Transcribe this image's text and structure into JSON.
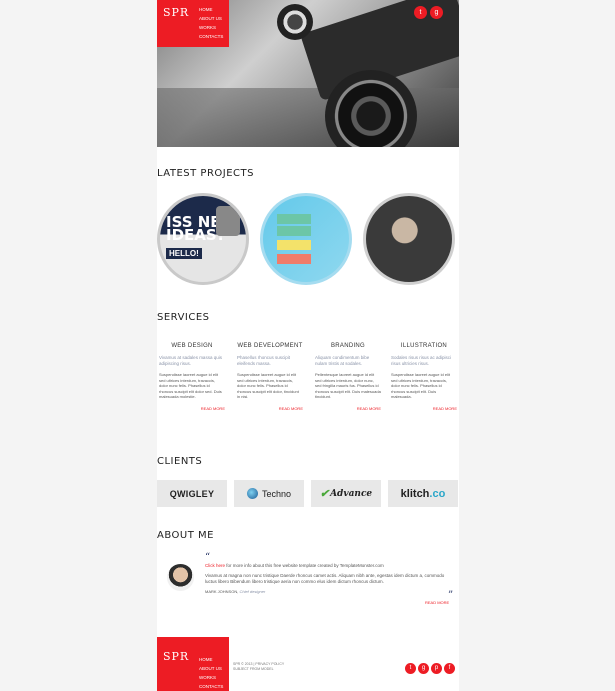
{
  "header": {
    "logo": "SPR",
    "nav": [
      "HOME",
      "ABOUT US",
      "WORKS",
      "CONTACTS"
    ],
    "social": [
      "twitter-icon",
      "google-plus-icon"
    ]
  },
  "sections": {
    "latest_projects": "LATEST PROJECTS",
    "services": "SERVICES",
    "clients": "CLIENTS",
    "about_me": "ABOUT ME"
  },
  "projects": {
    "p1_big": "ISS NEW IDEAS?",
    "p1_hello": "HELLO!"
  },
  "services": [
    {
      "title": "WEB DESIGN",
      "lead": "Vivamus at sadales massa quis adipiscing risus.",
      "text": "Suspendisse laoreet augue id elit sed ultrices interdum, travaccis, dolor nunc felis. Phasellus id rhoncus suscipit elit dolor sed. Duis malesuada molestie.",
      "more": "READ MORE"
    },
    {
      "title": "WEB DEVELOPMENT",
      "lead": "Phasellus rhoncus suscipit eleifends massa.",
      "text": "Suspendisse laoreet augue id elit sed ultrices interdum, travaccis, dolor nunc felis. Phasellus id rhoncus suscipit elit dolor, tincidunt in nisi.",
      "more": "READ MORE"
    },
    {
      "title": "BRANDING",
      "lead": "Aliquam condimentum bibe nulam tristis at sodales.",
      "text": "Pellentesque laoreet augue id elit sed ultrices interdum, dolor nunc, sed fringilla mauris fus. Phasellus id rhoncus suscipit elit. Duis malesuada tincidunt.",
      "more": "READ MORE"
    },
    {
      "title": "ILLUSTRATION",
      "lead": "Sodales risus risus ac adipisci risus ultricies risus.",
      "text": "Suspendisse laoreet augue id elit sed ultrices interdum, travaccis, dolor nunc felis. Phasellus id rhoncus suscipit elit. Duis malesuada.",
      "more": "READ MORE"
    }
  ],
  "clients": {
    "c1": "QWIGLEY",
    "c2": "Techno",
    "c3": "Advance",
    "c4_main": "klitch",
    "c4_co": ".co"
  },
  "about": {
    "link_text": "Click here",
    "intro": " for more info about this free website template created by TemplateMonster.com",
    "body": "Vivamus at magna non nunc tristique Daerde rhoncus camet actis. Aliquam nibh ante, egestas idem dictum a, commodo luctus libero Bibendum libero tristique aeria non commo elus idem dictum rhoncus dictum.",
    "name": "MARK JOHNSON,",
    "role": " Chief designer",
    "more": "READ MORE"
  },
  "footer": {
    "logo": "SPR",
    "nav": [
      "HOME",
      "ABOUT US",
      "WORKS",
      "CONTACTS"
    ],
    "copy": "SPR © 2013 | PRIVACY POLICY",
    "copy2": "SUBJECT FROM MODEL",
    "social": [
      "twitter-icon",
      "google-plus-icon",
      "pinterest-icon",
      "facebook-icon"
    ]
  },
  "colors": {
    "accent": "#ed1c24"
  }
}
